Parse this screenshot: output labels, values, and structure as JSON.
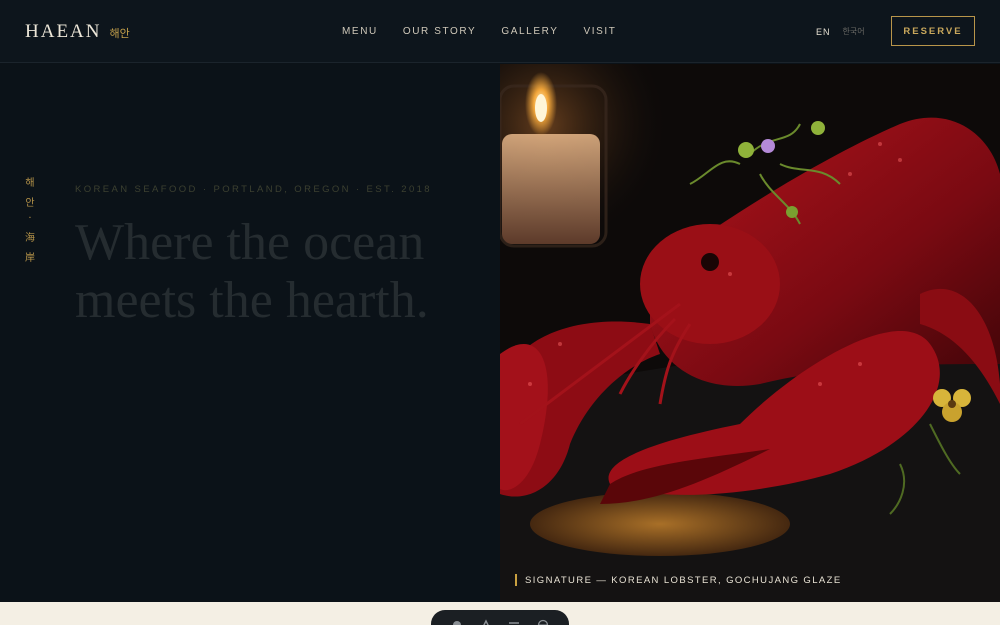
{
  "brand": {
    "name": "HAEAN",
    "name_ko": "해안"
  },
  "nav": {
    "items": [
      "MENU",
      "OUR STORY",
      "GALLERY",
      "VISIT"
    ]
  },
  "lang": {
    "en": "EN",
    "ko": "한국어"
  },
  "reserve_label": "RESERVE",
  "hero": {
    "vertical_ko": [
      "해",
      "안",
      "·",
      "海",
      "岸"
    ],
    "eyebrow": "KOREAN SEAFOOD · PORTLAND, OREGON · EST. 2018",
    "headline_line1": "Where the ocean",
    "headline_line2": "meets the hearth.",
    "caption": "SIGNATURE — KOREAN LOBSTER, GOCHUJANG GLAZE"
  },
  "colors": {
    "accent": "#c9a85c",
    "background": "#0b1218",
    "footer": "#f4efe4"
  },
  "toolbar_icons": [
    "pointer-icon",
    "hand-icon",
    "lines-icon",
    "globe-icon"
  ]
}
